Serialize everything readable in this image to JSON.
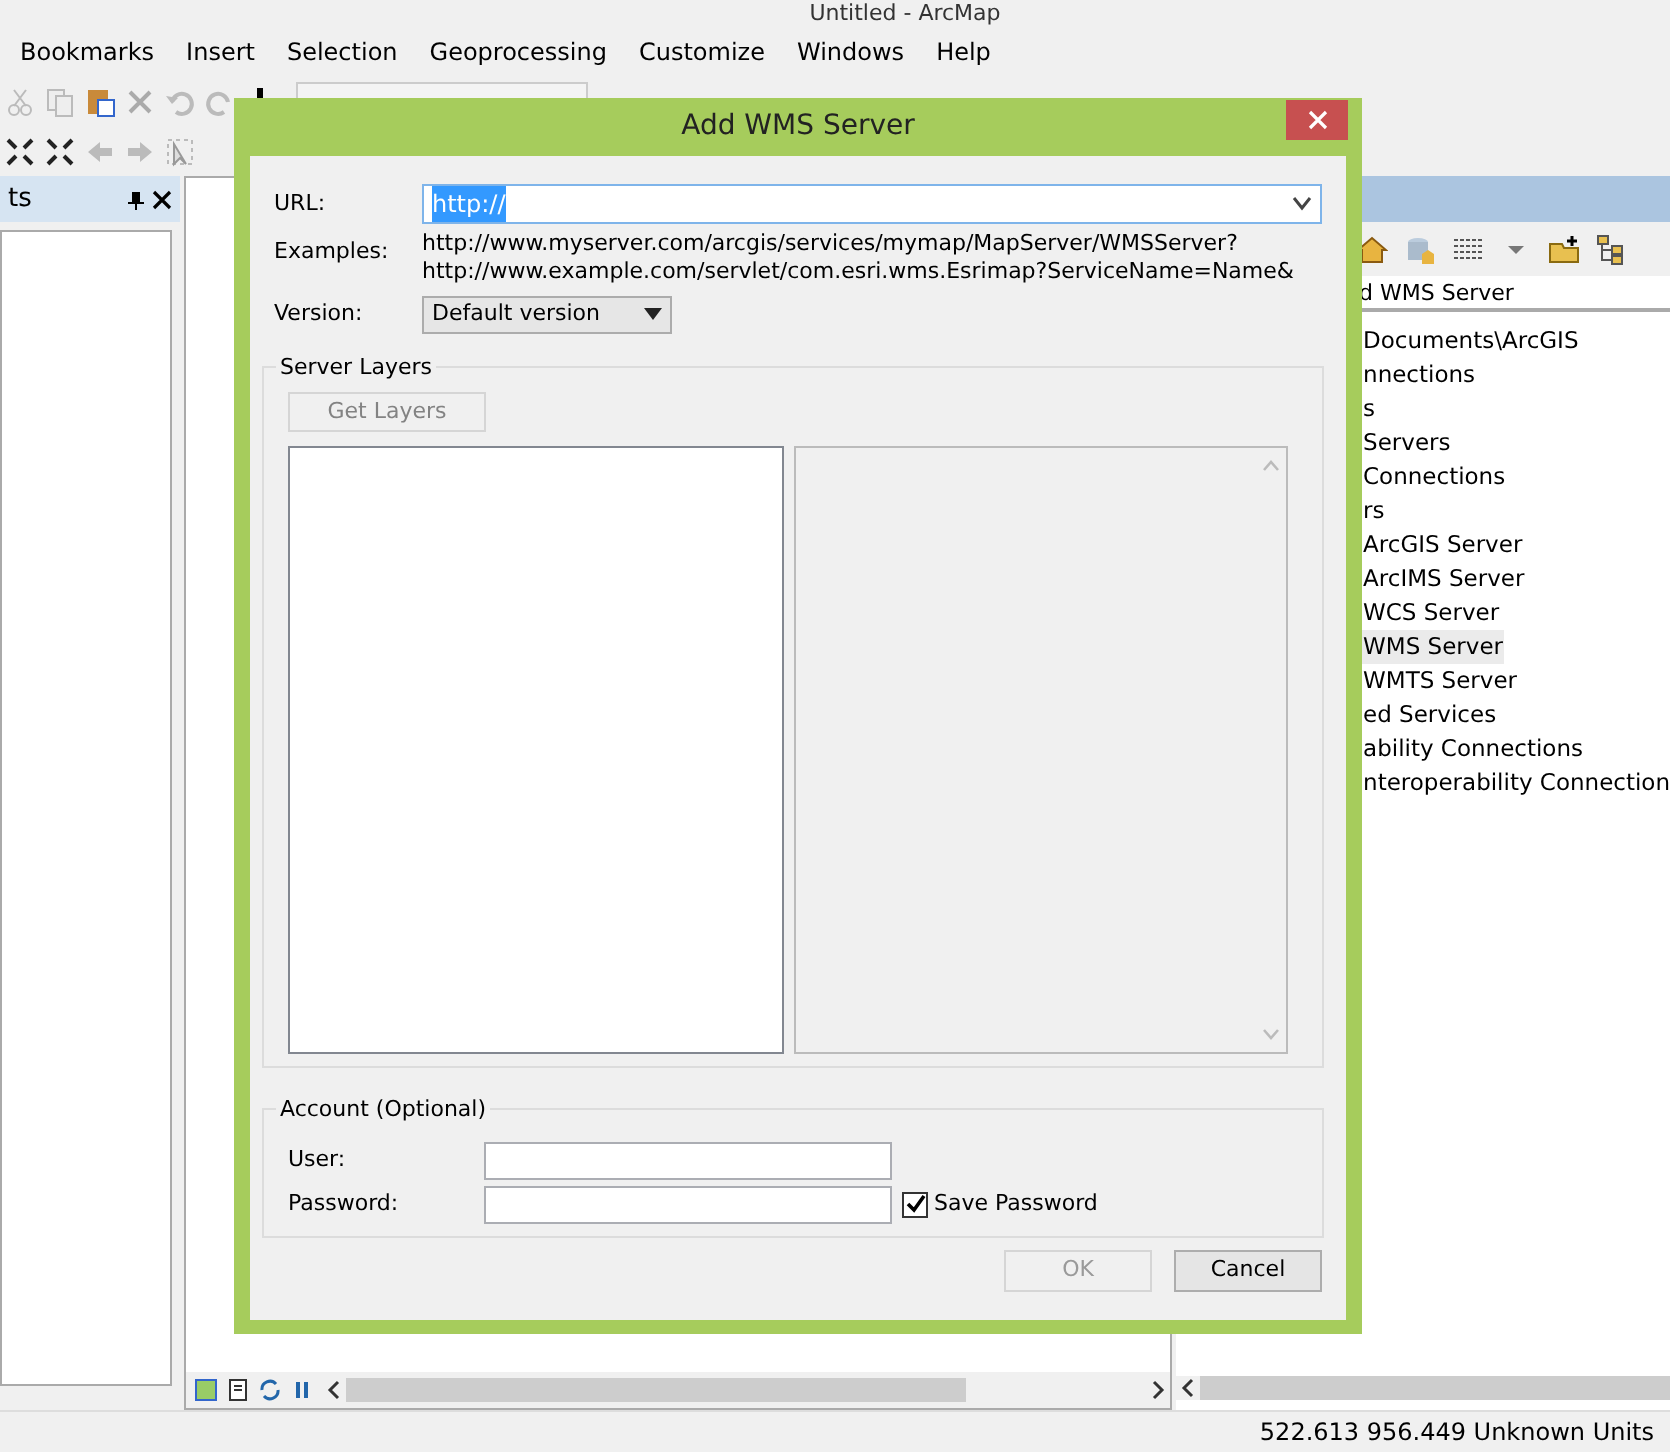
{
  "app": {
    "title": "Untitled - ArcMap"
  },
  "menu": [
    "Bookmarks",
    "Insert",
    "Selection",
    "Geoprocessing",
    "Customize",
    "Windows",
    "Help"
  ],
  "toc_panel": {
    "title": "ts"
  },
  "catalog": {
    "location": "d WMS Server",
    "items": [
      {
        "label": "Documents\\ArcGIS",
        "selected": false
      },
      {
        "label": "nnections",
        "selected": false
      },
      {
        "label": "s",
        "selected": false
      },
      {
        "label": "Servers",
        "selected": false
      },
      {
        "label": "Connections",
        "selected": false
      },
      {
        "label": "rs",
        "selected": false
      },
      {
        "label": "ArcGIS Server",
        "selected": false
      },
      {
        "label": "ArcIMS Server",
        "selected": false
      },
      {
        "label": "WCS Server",
        "selected": false
      },
      {
        "label": "WMS Server",
        "selected": true
      },
      {
        "label": "WMTS Server",
        "selected": false
      },
      {
        "label": "ed Services",
        "selected": false
      },
      {
        "label": "ability Connections",
        "selected": false
      },
      {
        "label": "nteroperability Connection",
        "selected": false
      }
    ]
  },
  "status_bar": {
    "coordinates": "522.613 956.449 Unknown Units"
  },
  "dialog": {
    "title": "Add WMS Server",
    "url_label": "URL:",
    "url_value": "http://",
    "examples_label": "Examples:",
    "examples": [
      "http://www.myserver.com/arcgis/services/mymap/MapServer/WMSServer?",
      "http://www.example.com/servlet/com.esri.wms.Esrimap?ServiceName=Name&"
    ],
    "version_label": "Version:",
    "version_value": "Default version",
    "server_layers": {
      "title": "Server Layers",
      "get_layers_button": {
        "label": "Get Layers",
        "disabled": true
      }
    },
    "account": {
      "title": "Account (Optional)",
      "user_label": "User:",
      "password_label": "Password:",
      "save_password": {
        "label": "Save Password",
        "checked": true
      }
    },
    "buttons": [
      {
        "label": "OK",
        "disabled": true
      },
      {
        "label": "Cancel",
        "disabled": false
      }
    ]
  }
}
